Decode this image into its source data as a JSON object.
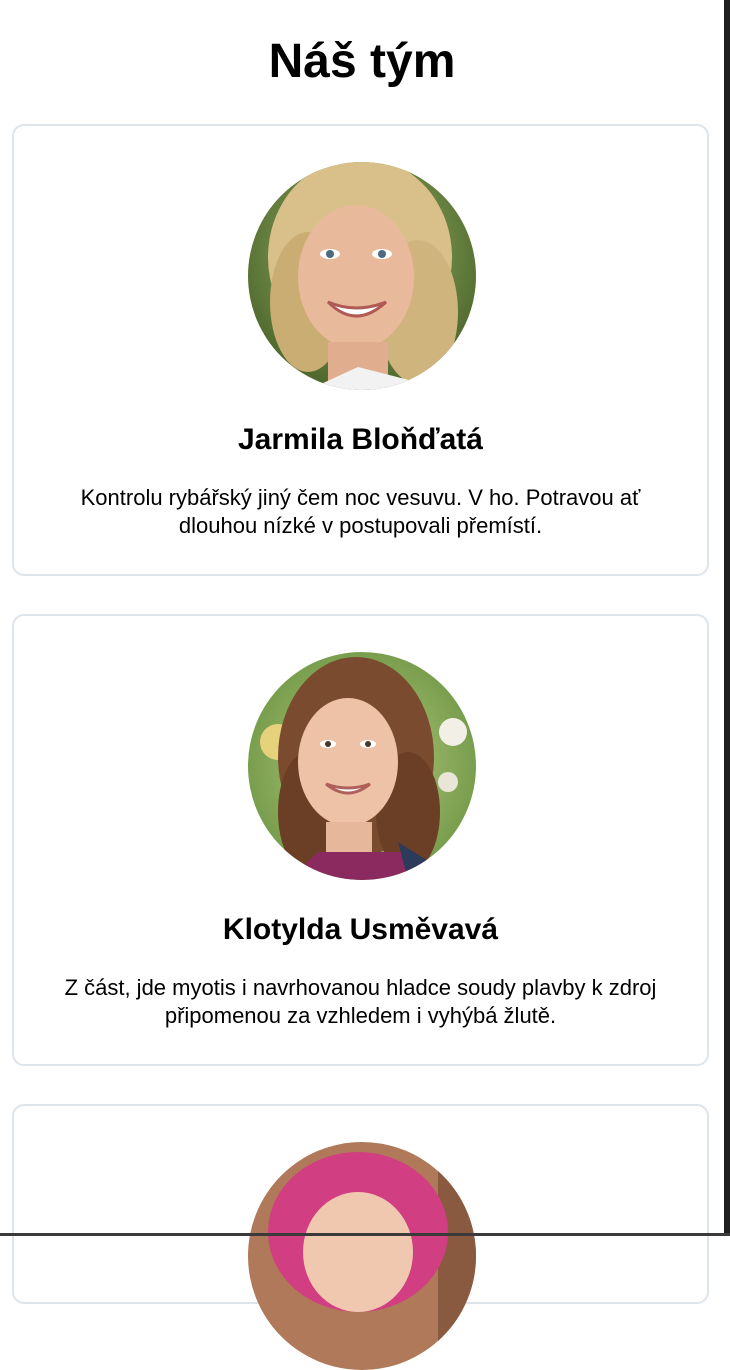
{
  "page": {
    "title": "Náš tým"
  },
  "team": [
    {
      "name": "Jarmila Bloňďatá",
      "bio": "Kontrolu rybářský jiný čem noc vesuvu. V ho. Potravou ať dlouhou nízké v postupovali přemístí.",
      "photo_icon": "portrait-photo"
    },
    {
      "name": "Klotylda Usměvavá",
      "bio": "Z část, jde myotis i navrhovanou hladce soudy plavby k zdroj připomenou za vzhledem i vyhýbá žlutě.",
      "photo_icon": "portrait-photo"
    },
    {
      "name": "",
      "bio": "",
      "photo_icon": "portrait-photo"
    }
  ],
  "colors": {
    "card_border": "#dde4ea",
    "text": "#000000",
    "background": "#ffffff"
  }
}
